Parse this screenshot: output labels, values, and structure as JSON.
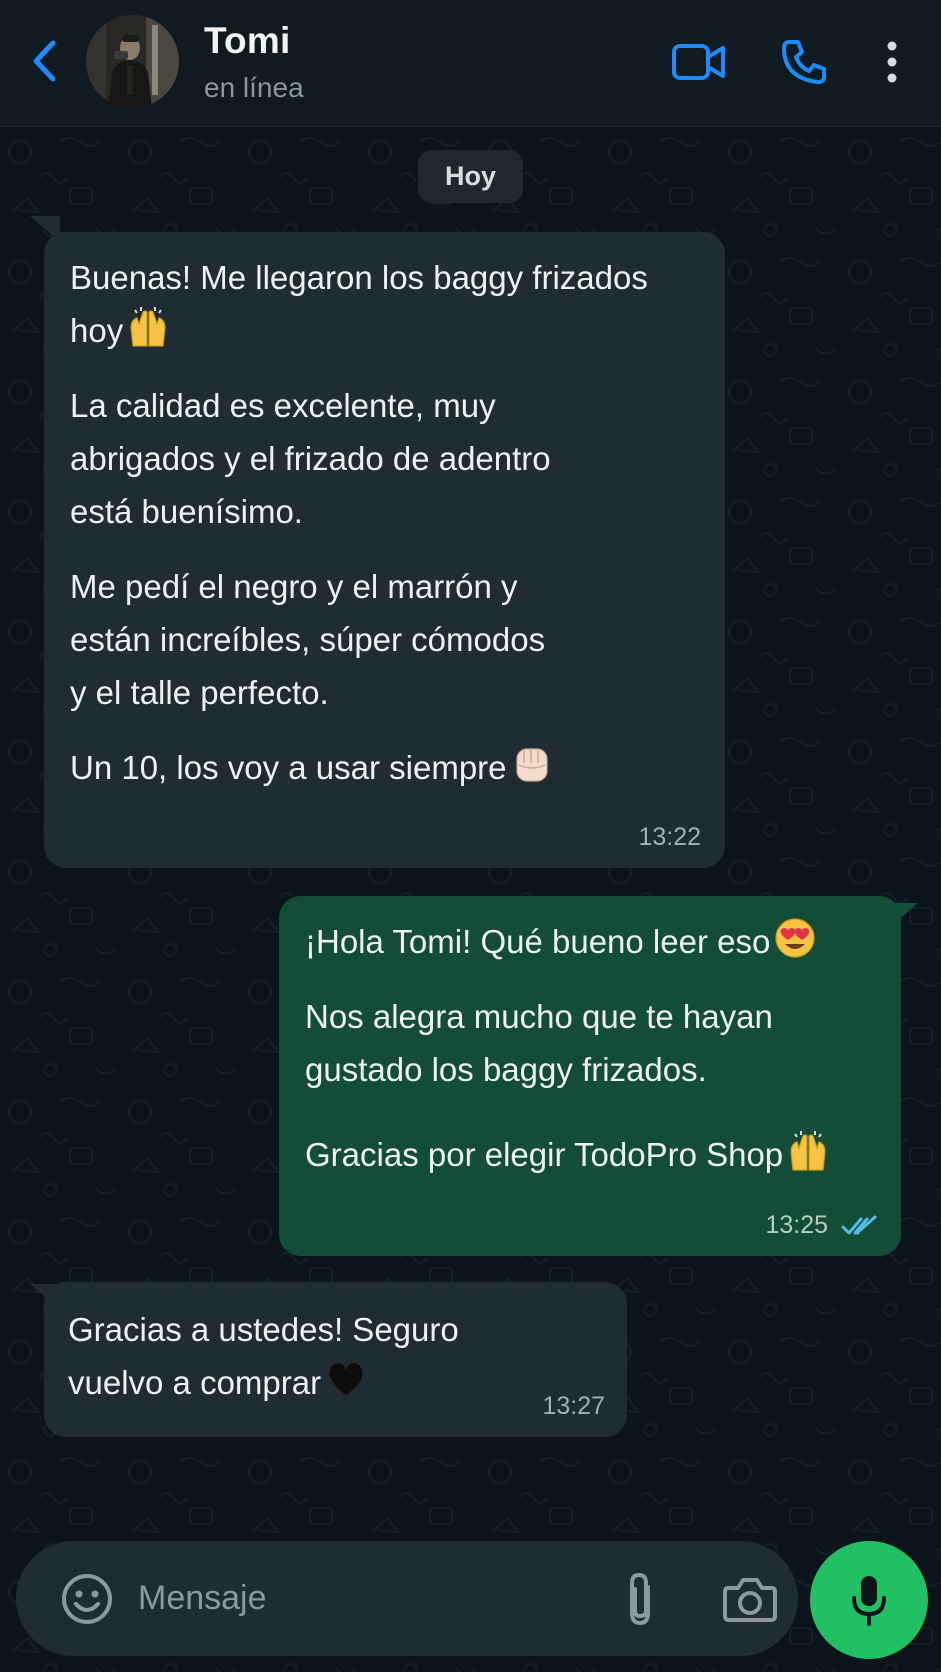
{
  "header": {
    "contact_name": "Tomi",
    "status": "en línea",
    "icons": [
      "back-arrow-icon",
      "video-call-icon",
      "voice-call-icon",
      "more-options-icon"
    ]
  },
  "chat": {
    "date_chip": "Hoy",
    "messages": [
      {
        "direction": "incoming",
        "lines": [
          "Buenas! Me llegaron los baggy frizados",
          "hoy",
          "La calidad es excelente, muy",
          "abrigados y el frizado de adentro",
          "está buenísimo.",
          "Me pedí el negro y el marrón y",
          "están increíbles, súper cómodos",
          "y el talle perfecto.",
          "Un 10, los voy a usar siempre"
        ],
        "emojis": [
          "raising-hands-emoji",
          "fist-emoji"
        ],
        "time": "13:22"
      },
      {
        "direction": "outgoing",
        "lines": [
          "¡Hola Tomi! Qué bueno leer eso",
          "Nos alegra mucho que te hayan",
          "gustado los baggy frizados.",
          "Gracias por elegir TodoPro Shop"
        ],
        "emojis": [
          "heart-eyes-emoji",
          "raising-hands-emoji"
        ],
        "time": "13:25",
        "status": "read"
      },
      {
        "direction": "incoming",
        "lines": [
          "Gracias a ustedes! Seguro",
          "vuelvo a comprar"
        ],
        "emojis": [
          "black-heart-emoji"
        ],
        "time": "13:27"
      }
    ]
  },
  "input": {
    "placeholder": "Mensaje",
    "icons": [
      "emoji-icon",
      "attach-icon",
      "camera-icon",
      "mic-icon"
    ]
  },
  "colors": {
    "accent_blue": "#1a8cff",
    "send_green": "#21c063",
    "incoming_bubble": "#1f2c34",
    "outgoing_bubble": "#144d37",
    "read_ticks": "#53bdeb"
  }
}
